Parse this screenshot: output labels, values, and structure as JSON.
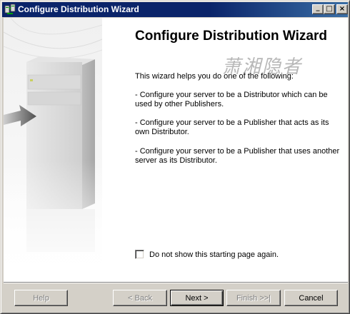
{
  "window": {
    "title": "Configure Distribution Wizard",
    "controls": {
      "minimize": "_",
      "maximize": "□",
      "close": "×"
    }
  },
  "icons": {
    "app": "distribution-wizard-icon",
    "art": "server-tower-with-arrow-illustration"
  },
  "page": {
    "heading": "Configure Distribution Wizard",
    "watermark": "萧湘隐者",
    "intro": "This wizard helps you do one of the following:",
    "bullets": [
      "- Configure your server to be a Distributor which can be used by other Publishers.",
      "- Configure your server to be a Publisher that acts as its own Distributor.",
      "- Configure your server to be a Publisher that uses another server as its Distributor."
    ],
    "checkbox": {
      "label": "Do not show this starting page again.",
      "checked": false
    }
  },
  "buttons": {
    "help": "Help",
    "back": "< Back",
    "next": "Next >",
    "finish": "Finish >>|",
    "cancel": "Cancel"
  },
  "colors": {
    "titlebar": "#0a246a",
    "face": "#d4d0c8",
    "content_bg": "#ffffff",
    "disabled_text": "#808080"
  }
}
